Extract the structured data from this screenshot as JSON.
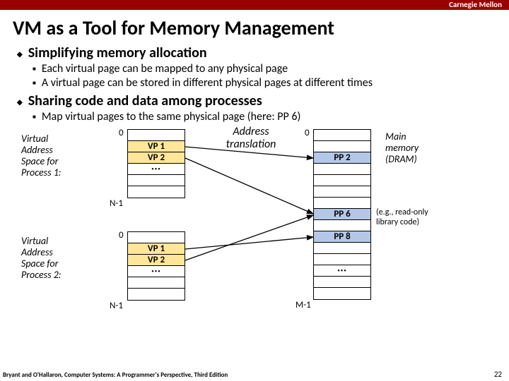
{
  "topbar": "Carnegie Mellon",
  "title": "VM as a Tool for Memory Management",
  "b1": "Simplifying memory allocation",
  "b1a": "Each virtual page can be mapped to any physical page",
  "b1b": "A virtual page can be stored in different physical pages at different times",
  "b2": "Sharing code and data among processes",
  "b2a": "Map virtual pages to the same physical page (here: PP 6)",
  "proc1": "Virtual\nAddress\nSpace for\nProcess 1:",
  "proc2": "Virtual\nAddress\nSpace for\nProcess 2:",
  "zero": "0",
  "nminus1": "N-1",
  "mminus1": "M-1",
  "vp1": "VP 1",
  "vp2": "VP 2",
  "pp2": "PP 2",
  "pp6": "PP 6",
  "pp8": "PP 8",
  "dots": "···",
  "addrTrans": "Address\ntranslation",
  "mainmem": "Main\nmemory\n(DRAM)",
  "readonly": "(e.g., read-only\nlibrary code)",
  "footer": "Bryant and O'Hallaron, Computer Systems: A Programmer's Perspective, Third Edition",
  "pagenum": "22"
}
